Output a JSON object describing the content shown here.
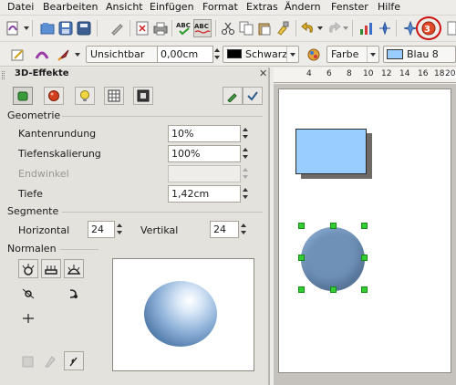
{
  "menubar": {
    "items": [
      "Datei",
      "Bearbeiten",
      "Ansicht",
      "Einfügen",
      "Format",
      "Extras",
      "Ändern",
      "Fenster",
      "Hilfe"
    ]
  },
  "toolbar": {
    "line_style_value": "Unsichtbar",
    "line_width_value": "0,00cm",
    "line_color_value": "Schwarz",
    "line_color_swatch": "#000000",
    "area_style_value": "Farbe",
    "area_color_value": "Blau 8",
    "area_color_swatch": "#99ccff"
  },
  "ruler": {
    "numbers": [
      "4",
      "6",
      "8",
      "10",
      "12",
      "14",
      "16",
      "18",
      "20"
    ]
  },
  "panel": {
    "title": "3D-Effekte",
    "geometrie": {
      "section": "Geometrie",
      "kantenrundung_label": "Kantenrundung",
      "kantenrundung_value": "10%",
      "tiefenskalierung_label": "Tiefenskalierung",
      "tiefenskalierung_value": "100%",
      "endwinkel_label": "Endwinkel",
      "endwinkel_value": "",
      "tiefe_label": "Tiefe",
      "tiefe_value": "1,42cm"
    },
    "segmente": {
      "section": "Segmente",
      "horizontal_label": "Horizontal",
      "horizontal_value": "24",
      "vertikal_label": "Vertikal",
      "vertikal_value": "24"
    },
    "normalen": {
      "section": "Normalen"
    }
  },
  "colors": {
    "accent_highlight": "#cc1111",
    "selection_handles": "#33cc33",
    "rectangle_fill": "#99ccff",
    "circle_fill": "#6f91b8"
  }
}
